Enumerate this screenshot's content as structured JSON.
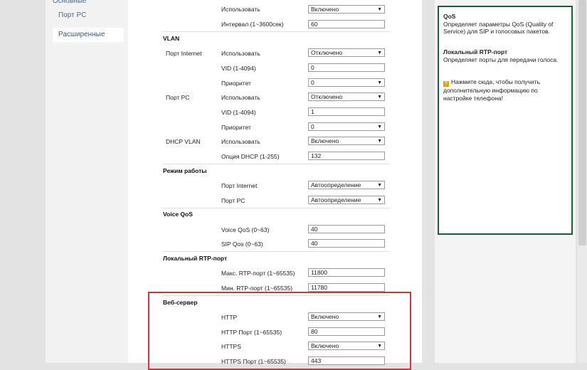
{
  "nav": {
    "items": [
      {
        "label": "Основные"
      },
      {
        "label": "Порт PC"
      },
      {
        "label": "Расширенные"
      }
    ]
  },
  "rows": {
    "r1": {
      "label": "Использовать",
      "value": "Включено"
    },
    "r2": {
      "label": "Интервал (1~3600сек)",
      "value": "60"
    },
    "vlan_title": "VLAN",
    "port_internet": "Порт Internet",
    "r3": {
      "label": "Использовать",
      "value": "Отключено"
    },
    "r4": {
      "label": "VID (1-4094)",
      "value": "0"
    },
    "r5": {
      "label": "Приоритет",
      "value": "0"
    },
    "port_pc": "Порт PC",
    "r6": {
      "label": "Использовать",
      "value": "Отключено"
    },
    "r7": {
      "label": "VID (1-4094)",
      "value": "1"
    },
    "r8": {
      "label": "Приоритет",
      "value": "0"
    },
    "dhcp_vlan": "DHCP VLAN",
    "r9": {
      "label": "Использовать",
      "value": "Включено"
    },
    "r10": {
      "label": "Опция DHCP (1-255)",
      "value": "132"
    },
    "mode_title": "Режим работы",
    "r11": {
      "label": "Порт Internet",
      "value": "Автоопределение"
    },
    "r12": {
      "label": "Порт PC",
      "value": "Автоопределение"
    },
    "qos_title": "Voice QoS",
    "r13": {
      "label": "Voice QoS (0~63)",
      "value": "40"
    },
    "r14": {
      "label": "SIP Qos (0~63)",
      "value": "40"
    },
    "rtp_title": "Локальный RTP-порт",
    "r15": {
      "label": "Макс. RTP-порт (1~65535)",
      "value": "11800"
    },
    "r16": {
      "label": "Мин. RTP-порт (1~65535)",
      "value": "11780"
    },
    "web_title": "Веб-сервер",
    "r17": {
      "label": "HTTP",
      "value": "Включено"
    },
    "r18": {
      "label": "HTTP Порт (1~65535)",
      "value": "80"
    },
    "r19": {
      "label": "HTTPS",
      "value": "Включено"
    },
    "r20": {
      "label": "HTTPS Порт (1~65535)",
      "value": "443"
    }
  },
  "help": {
    "qos_title": "QoS",
    "qos_text": "Определяет параметры QoS (Quality of Service) для SIP и голосовых пакетов.",
    "rtp_title": "Локальный RTP-порт",
    "rtp_text": "Определяет порты для передачи голоса.",
    "hint": "Нажмите сюда, чтобы получить дополнительную информацию по настройке телефона!",
    "hint_icon": "question-icon"
  },
  "colors": {
    "help_border": "#1e5d34",
    "highlight_box": "#d9323a",
    "nav_link": "#4a6c93"
  }
}
